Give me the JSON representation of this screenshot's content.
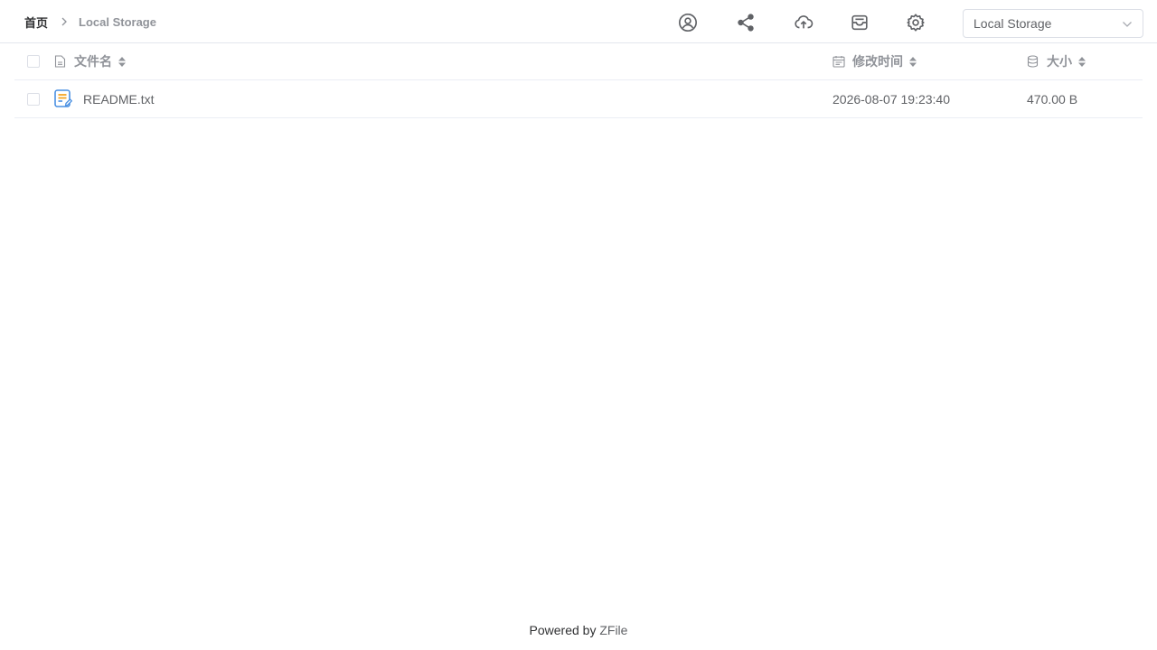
{
  "breadcrumb": {
    "home": "首页",
    "current": "Local Storage",
    "separator_icon": "chevron-right-icon"
  },
  "toolbar": {
    "icons": [
      "user-circle-icon",
      "share-icon",
      "cloud-upload-icon",
      "inbox-icon",
      "gear-icon"
    ]
  },
  "storage_select": {
    "value": "Local Storage",
    "icon": "chevron-down-icon"
  },
  "table": {
    "headers": {
      "name": "文件名",
      "time": "修改时间",
      "size": "大小"
    },
    "rows": [
      {
        "name": "README.txt",
        "time": "2026-08-07 19:23:40",
        "size": "470.00 B",
        "icon": "text-file-icon"
      }
    ]
  },
  "footer": {
    "prefix": "Powered by",
    "link": "ZFile"
  },
  "colors": {
    "icon": "#606266",
    "muted": "#909399",
    "border": "#e4e7ed",
    "file_icon_blue": "#4a90e2",
    "file_icon_orange": "#f5a623"
  }
}
